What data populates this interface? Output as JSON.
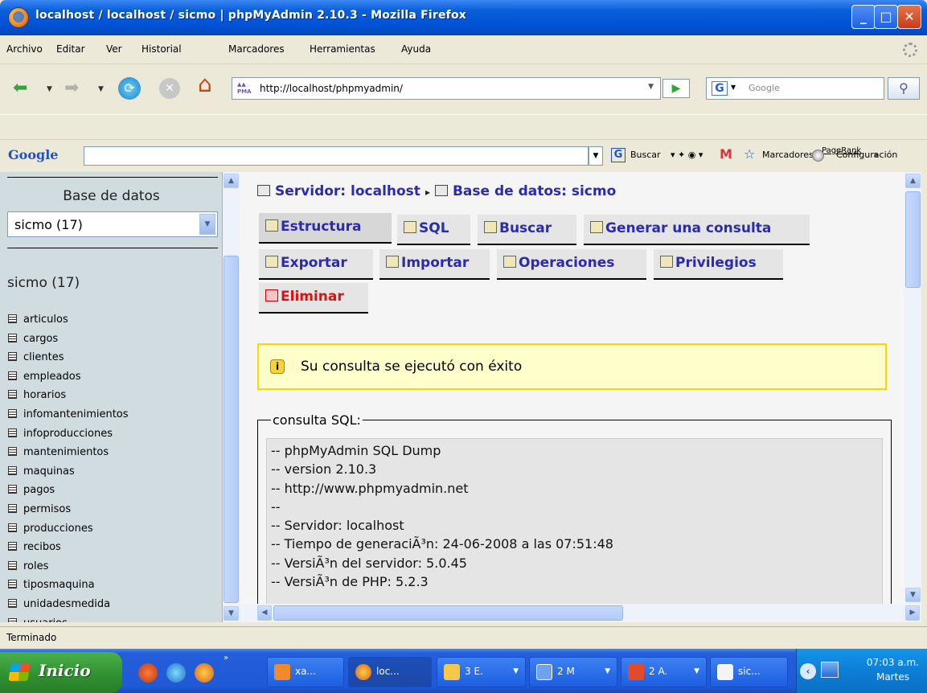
{
  "window": {
    "title": "localhost / localhost / sicmo | phpMyAdmin 2.10.3 - Mozilla Firefox"
  },
  "menu": [
    "Archivo",
    "Editar",
    "Ver",
    "Historial",
    "Marcadores",
    "Herramientas",
    "Ayuda"
  ],
  "nav": {
    "url": "http://localhost/phpmyadmin/",
    "search_placeholder": "Google"
  },
  "google_toolbar": {
    "logo": "Google",
    "search": "Buscar",
    "bookmarks": "Marcadores",
    "pagerank": "PageRank",
    "more": "»",
    "settings": "Configuración"
  },
  "sidebar": {
    "heading": "Base de datos",
    "selected_db": "sicmo (17)",
    "db_title": "sicmo (17)",
    "tables": [
      "articulos",
      "cargos",
      "clientes",
      "empleados",
      "horarios",
      "infomantenimientos",
      "infoproducciones",
      "mantenimientos",
      "maquinas",
      "pagos",
      "permisos",
      "producciones",
      "recibos",
      "roles",
      "tiposmaquina",
      "unidadesmedida",
      "usuarios"
    ]
  },
  "breadcrumb": {
    "server": "Servidor: localhost",
    "database": "Base de datos: sicmo",
    "separator": "▸"
  },
  "tabs": {
    "structure": "Estructura",
    "sql": "SQL",
    "search": "Buscar",
    "query": "Generar una consulta",
    "export": "Exportar",
    "import": "Importar",
    "operations": "Operaciones",
    "privileges": "Privilegios",
    "drop": "Eliminar"
  },
  "notice": {
    "message": "Su consulta se ejecutó con éxito"
  },
  "sql": {
    "legend": "consulta SQL:",
    "lines": [
      "-- phpMyAdmin SQL Dump",
      "-- version 2.10.3",
      "-- http://www.phpmyadmin.net",
      "--",
      "-- Servidor: localhost",
      "-- Tiempo de generaciÃ³n: 24-06-2008 a las 07:51:48",
      "-- VersiÃ³n del servidor: 5.0.45",
      "-- VersiÃ³n de PHP: 5.2.3"
    ]
  },
  "status": "Terminado",
  "taskbar": {
    "start": "Inicio",
    "buttons": [
      "xa...",
      "loc...",
      "3 E.",
      "2 M",
      "2 A.",
      "sic..."
    ],
    "time": "07:03 a.m.",
    "day": "Martes"
  }
}
